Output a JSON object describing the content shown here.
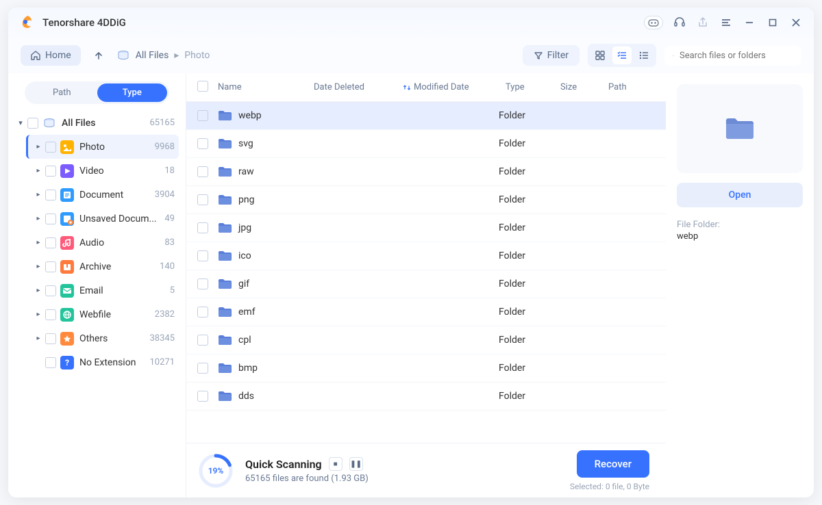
{
  "app": {
    "title": "Tenorshare 4DDiG"
  },
  "toolbar": {
    "home": "Home",
    "filter": "Filter",
    "search_placeholder": "Search files or folders",
    "breadcrumb": {
      "root": "All Files",
      "leaf": "Photo"
    }
  },
  "sidebar": {
    "tab_path": "Path",
    "tab_type": "Type",
    "root": {
      "label": "All Files",
      "count": "65165"
    },
    "items": [
      {
        "label": "Photo",
        "count": "9968",
        "color": "#ffb300",
        "selected": true
      },
      {
        "label": "Video",
        "count": "18",
        "color": "#7c5cff"
      },
      {
        "label": "Document",
        "count": "3904",
        "color": "#2f9bff"
      },
      {
        "label": "Unsaved Docum...",
        "count": "49",
        "color": "#2f9bff"
      },
      {
        "label": "Audio",
        "count": "83",
        "color": "#ff5a7a"
      },
      {
        "label": "Archive",
        "count": "140",
        "color": "#ff7a3d"
      },
      {
        "label": "Email",
        "count": "5",
        "color": "#22c59b"
      },
      {
        "label": "Webfile",
        "count": "2382",
        "color": "#22c59b"
      },
      {
        "label": "Others",
        "count": "38345",
        "color": "#ff8a3d"
      },
      {
        "label": "No Extension",
        "count": "10271",
        "color": "#3772ff",
        "noexpand": true
      }
    ]
  },
  "table": {
    "cols": {
      "name": "Name",
      "date_deleted": "Date Deleted",
      "modified": "Modified Date",
      "type": "Type",
      "size": "Size",
      "path": "Path"
    },
    "rows": [
      {
        "name": "webp",
        "type": "Folder",
        "selected": true
      },
      {
        "name": "svg",
        "type": "Folder"
      },
      {
        "name": "raw",
        "type": "Folder"
      },
      {
        "name": "png",
        "type": "Folder"
      },
      {
        "name": "jpg",
        "type": "Folder"
      },
      {
        "name": "ico",
        "type": "Folder"
      },
      {
        "name": "gif",
        "type": "Folder"
      },
      {
        "name": "emf",
        "type": "Folder"
      },
      {
        "name": "cpl",
        "type": "Folder"
      },
      {
        "name": "bmp",
        "type": "Folder"
      },
      {
        "name": "dds",
        "type": "Folder"
      }
    ]
  },
  "detail": {
    "open": "Open",
    "meta_label": "File Folder:",
    "meta_value": "webp"
  },
  "footer": {
    "percent": "19%",
    "title": "Quick Scanning",
    "sub": "65165 files are found (1.93 GB)",
    "recover": "Recover",
    "selected": "Selected: 0 file, 0 Byte"
  }
}
